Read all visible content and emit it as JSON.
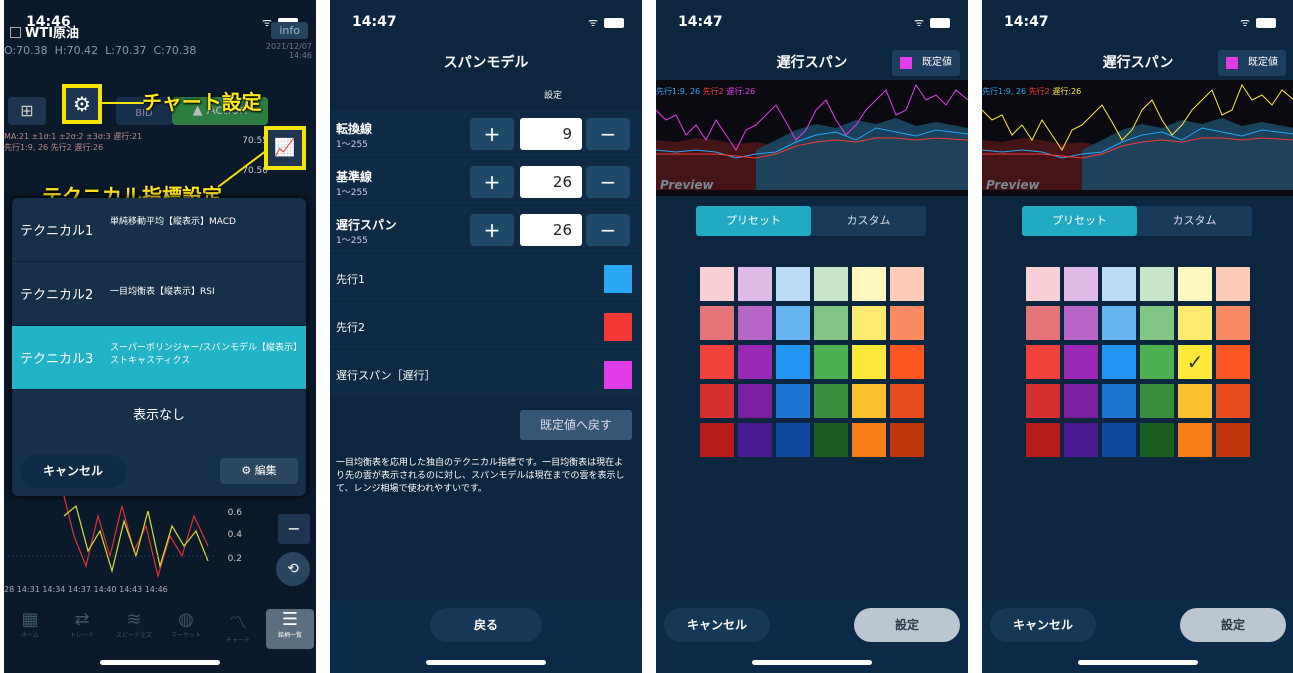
{
  "p1": {
    "time": "14:46",
    "symbol": "WTI原油",
    "info": "info",
    "ohlc": [
      "O:70.38",
      "H:70.42",
      "L:70.37",
      "C:70.38"
    ],
    "date": "2021/12/07",
    "date_time": "14:46",
    "bid": "BID",
    "action": "Action",
    "callout_chart": "チャート設定",
    "callout_tech": "テクニカル指標設定",
    "chart_labels": "MA:21  ±1σ:1  ±2σ:2  ±3σ:3  遅行:21",
    "chart_labels2": "先行1:9, 26  先行2  遅行:26",
    "price_top": "70.55",
    "price_mid": "70.50",
    "modal": {
      "items": [
        {
          "label": "テクニカル1",
          "value": "単純移動平均【縦表示】MACD"
        },
        {
          "label": "テクニカル2",
          "value": "一目均衡表【縦表示】RSI"
        },
        {
          "label": "テクニカル3",
          "value": "スーパーボリンジャー/スパンモデル【縦表示】ストキャスティクス"
        }
      ],
      "none": "表示なし",
      "cancel": "キャンセル",
      "edit": "編集"
    },
    "sub_vals": [
      "0.6",
      "0.4",
      "0.2"
    ],
    "times": "28  14:31  14:34  14:37  14:40  14:43  14:46",
    "nav": [
      "ホーム",
      "トレード",
      "スピード注文",
      "マーケット",
      "チャート",
      "銘柄一覧"
    ]
  },
  "p2": {
    "time": "14:47",
    "title": "スパンモデル",
    "setting_caption": "設定",
    "params": [
      {
        "name": "転換線",
        "range": "1～255",
        "value": "9"
      },
      {
        "name": "基準線",
        "range": "1～255",
        "value": "26"
      },
      {
        "name": "遅行スパン",
        "range": "1～255",
        "value": "26"
      }
    ],
    "plus": "+",
    "minus": "−",
    "colors": [
      {
        "name": "先行1",
        "color": "#2aa6f4"
      },
      {
        "name": "先行2",
        "color": "#f43a36"
      },
      {
        "name": "遅行スパン［遅行］",
        "color": "#e13ce9"
      }
    ],
    "reset": "既定値へ戻す",
    "description": "一目均衡表を応用した独自のテクニカル指標です。一目均衡表は現在より先の雲が表示されるのに対し、スパンモデルは現在までの雲を表示して、レンジ相場で使われやすいです。",
    "back": "戻る"
  },
  "p3": {
    "time": "14:47",
    "title": "遅行スパン",
    "default": "既定値",
    "legend": [
      "先行1:9, 26",
      "先行2",
      "遅行:26"
    ],
    "preview": "Preview",
    "tabs": [
      "プリセット",
      "カスタム"
    ],
    "cancel": "キャンセル",
    "ok": "設定"
  },
  "p4": {
    "time": "14:47",
    "title": "遅行スパン",
    "default": "既定値",
    "legend": [
      "先行1:9, 26",
      "先行2",
      "遅行:26"
    ],
    "preview": "Preview",
    "tabs": [
      "プリセット",
      "カスタム"
    ],
    "cancel": "キャンセル",
    "ok": "設定",
    "check": "✓"
  },
  "palette": [
    [
      "#fbcfd6",
      "#e0bbe6",
      "#bcdcf8",
      "#c8e6ca",
      "#fef7c0",
      "#fdcbba"
    ],
    [
      "#e4737a",
      "#b766c8",
      "#66b4f0",
      "#82c684",
      "#fdea6e",
      "#fb8a62"
    ],
    [
      "#f0413b",
      "#9a28b4",
      "#2196f2",
      "#4caf50",
      "#fde93b",
      "#fc5623"
    ],
    [
      "#d72f2f",
      "#7b1fa1",
      "#1c76d1",
      "#378d3c",
      "#fbc02d",
      "#e54b1b"
    ],
    [
      "#b61c1c",
      "#4a1a91",
      "#0f4aa0",
      "#1b5e20",
      "#f57e17",
      "#bf360c"
    ]
  ]
}
